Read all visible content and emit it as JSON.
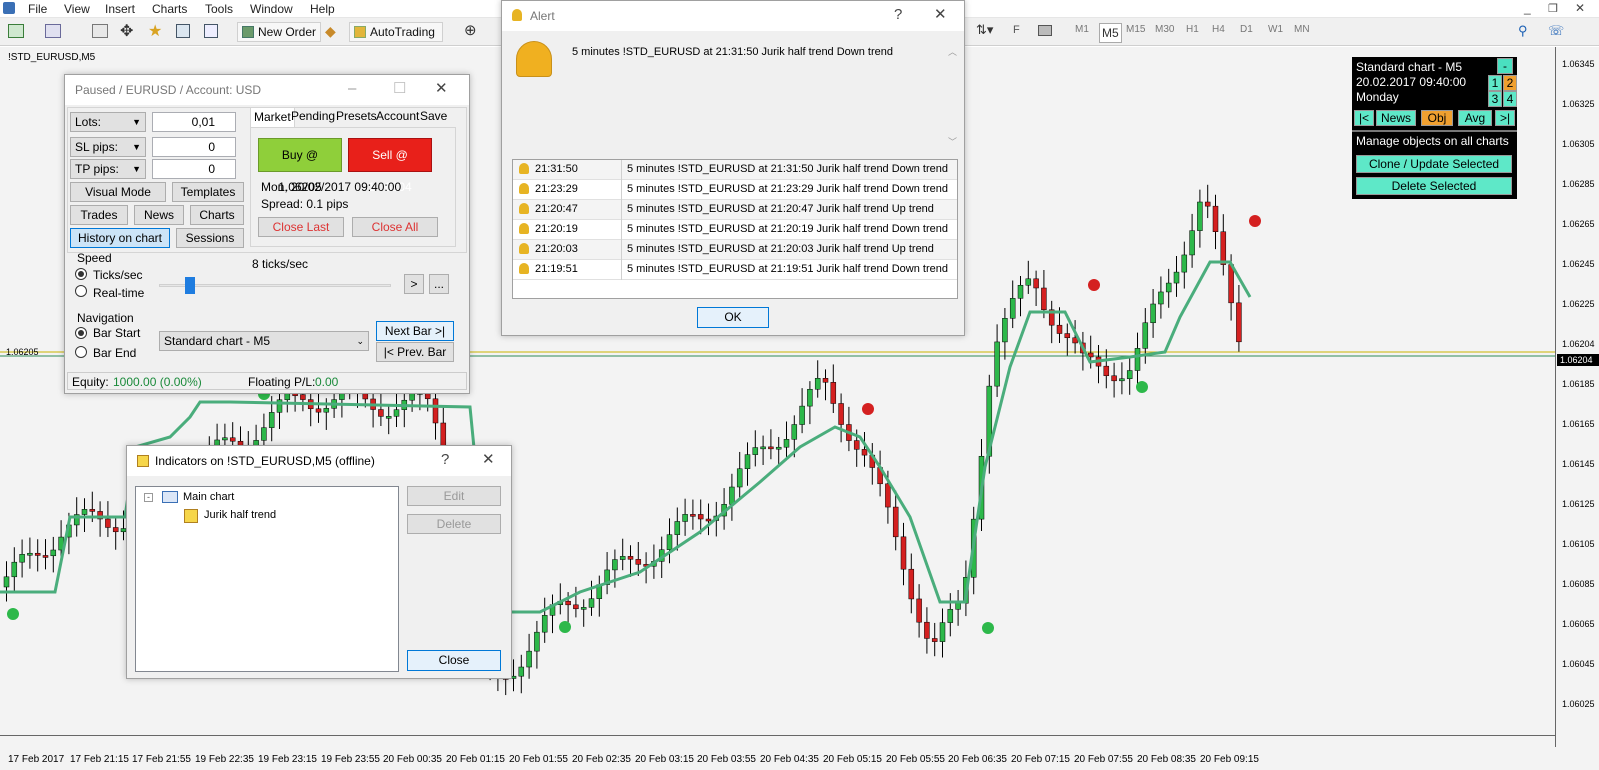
{
  "menu": {
    "items": [
      "File",
      "View",
      "Insert",
      "Charts",
      "Tools",
      "Window",
      "Help"
    ]
  },
  "toolbar": {
    "new_order": "New Order",
    "autotrading": "AutoTrading",
    "timeframes": [
      "M1",
      "M5",
      "M15",
      "M30",
      "H1",
      "H4",
      "D1",
      "W1",
      "MN"
    ],
    "selected_timeframe": "M5"
  },
  "chart": {
    "symbol_label": "!STD_EURUSD,M5",
    "price_tag": "1.06204",
    "left_price": "1.06205",
    "y_labels": [
      "1.06345",
      "1.06325",
      "1.06305",
      "1.06285",
      "1.06265",
      "1.06245",
      "1.06225",
      "1.06204",
      "1.06185",
      "1.06165",
      "1.06145",
      "1.06125",
      "1.06105",
      "1.06085",
      "1.06065",
      "1.06045",
      "1.06025"
    ],
    "x_labels": [
      "17 Feb 2017",
      "17 Feb 21:15",
      "17 Feb 21:55",
      "19 Feb 22:35",
      "19 Feb 23:15",
      "19 Feb 23:55",
      "20 Feb 00:35",
      "20 Feb 01:15",
      "20 Feb 01:55",
      "20 Feb 02:35",
      "20 Feb 03:15",
      "20 Feb 03:55",
      "20 Feb 04:35",
      "20 Feb 05:15",
      "20 Feb 05:55",
      "20 Feb 06:35",
      "20 Feb 07:15",
      "20 Feb 07:55",
      "20 Feb 08:35",
      "20 Feb 09:15"
    ],
    "colors": {
      "bull": "#2db84a",
      "bear": "#d42020",
      "trend_up": "#4aad7c",
      "trend_down": "#e8651e",
      "bg": "#f3f3f3"
    }
  },
  "tester": {
    "title": "Paused / EURUSD / Account: USD",
    "lots_label": "Lots:",
    "lots_value": "0,01",
    "sl_label": "SL pips:",
    "sl_value": "0",
    "tp_label": "TP pips:",
    "tp_value": "0",
    "visual_mode": "Visual Mode",
    "templates": "Templates",
    "trades": "Trades",
    "news": "News",
    "charts": "Charts",
    "history_on_chart": "History on chart",
    "sessions": "Sessions",
    "tabs": [
      "Market",
      "Pending",
      "Presets",
      "Account",
      "Save"
    ],
    "buy": "Buy @ 1.06205",
    "sell": "Sell @ 1.06204",
    "datetime": "Mon, 20/02/2017  09:40:00",
    "spread": "Spread: 0.1 pips",
    "close_last": "Close Last",
    "close_all": "Close All",
    "speed_label": "Speed",
    "ticks_sec": "Ticks/sec",
    "real_time": "Real-time",
    "speed_value": "8 ticks/sec",
    "play": ">",
    "more": "...",
    "navigation_label": "Navigation",
    "bar_start": "Bar Start",
    "bar_end": "Bar End",
    "chart_select": "Standard chart - M5",
    "next_bar": "Next Bar >|",
    "prev_bar": "|< Prev. Bar",
    "equity_label": "Equity:",
    "equity_value": "1000.00  (0.00%)",
    "floating_label": "Floating P/L:",
    "floating_value": "0.00"
  },
  "alert": {
    "title": "Alert",
    "message": "5 minutes !STD_EURUSD at 21:31:50 Jurik half trend Down trend",
    "ok": "OK",
    "rows": [
      {
        "time": "21:31:50",
        "msg": "5 minutes !STD_EURUSD at 21:31:50 Jurik half trend Down trend"
      },
      {
        "time": "21:23:29",
        "msg": "5 minutes !STD_EURUSD at 21:23:29 Jurik half trend Down trend"
      },
      {
        "time": "21:20:47",
        "msg": "5 minutes !STD_EURUSD at 21:20:47 Jurik half trend Up trend"
      },
      {
        "time": "21:20:19",
        "msg": "5 minutes !STD_EURUSD at 21:20:19 Jurik half trend Down trend"
      },
      {
        "time": "21:20:03",
        "msg": "5 minutes !STD_EURUSD at 21:20:03 Jurik half trend Up trend"
      },
      {
        "time": "21:19:51",
        "msg": "5 minutes !STD_EURUSD at 21:19:51 Jurik half trend Down trend"
      }
    ]
  },
  "indicators": {
    "title": "Indicators on !STD_EURUSD,M5 (offline)",
    "main_chart": "Main chart",
    "indicator": "Jurik half trend",
    "edit": "Edit",
    "delete": "Delete",
    "close": "Close"
  },
  "navpanel": {
    "chart": "Standard chart - M5",
    "minus": "-",
    "datetime": "20.02.2017    09:40:00",
    "day": "Monday",
    "n1": "1",
    "n2": "2",
    "n3": "3",
    "n4": "4",
    "first": "|<",
    "news": "News",
    "obj": "Obj",
    "avg": "Avg",
    "last": ">|",
    "manage": "Manage objects on all charts",
    "clone": "Clone / Update Selected",
    "delete_sel": "Delete Selected"
  }
}
